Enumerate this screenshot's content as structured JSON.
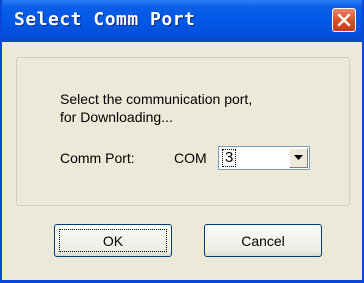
{
  "window": {
    "title": "Select Comm Port"
  },
  "dialog": {
    "prompt_line1": "Select the communication port,",
    "prompt_line2": "for Downloading...",
    "comm_port_label": "Comm Port:",
    "com_prefix": "COM",
    "com_value": "3"
  },
  "buttons": {
    "ok": "OK",
    "cancel": "Cancel"
  },
  "icons": {
    "close": "close-icon",
    "dropdown": "chevron-down-icon"
  },
  "colors": {
    "titlebar": "#0058e6",
    "close": "#d9522d",
    "dialog_bg": "#ece9d8"
  }
}
